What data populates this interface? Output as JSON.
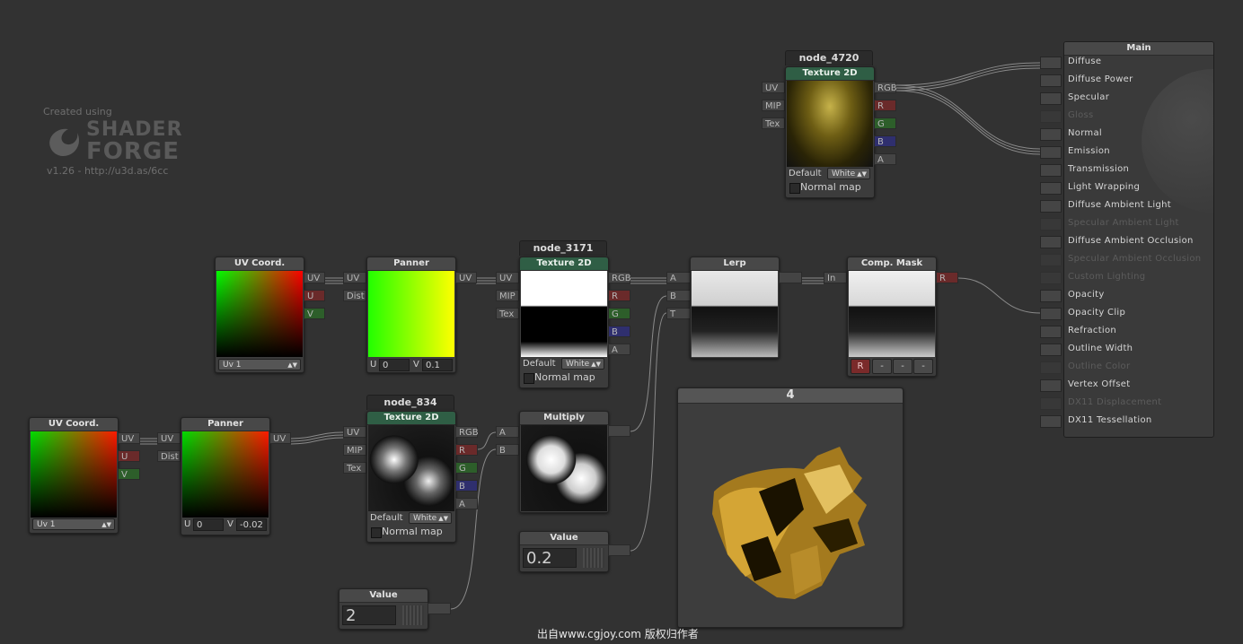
{
  "watermark": {
    "created_using": "Created using",
    "logo_line1": "SHADER",
    "logo_line2": "FORGE",
    "version": "v1.26 - http://u3d.as/6cc"
  },
  "footer_text": "出自www.cgjoy.com 版权归作者",
  "uv_coord_a": {
    "title": "UV Coord.",
    "outputs": [
      "UV",
      "U",
      "V"
    ],
    "dropdown": "Uv 1"
  },
  "uv_coord_b": {
    "title": "UV Coord.",
    "outputs": [
      "UV",
      "U",
      "V"
    ],
    "dropdown": "Uv 1"
  },
  "panner_a": {
    "title": "Panner",
    "inputs": [
      "UV",
      "Dist"
    ],
    "output": "UV",
    "u_label": "U",
    "u_value": "0",
    "v_label": "V",
    "v_value": "0.1"
  },
  "panner_b": {
    "title": "Panner",
    "inputs": [
      "UV",
      "Dist"
    ],
    "output": "UV",
    "u_label": "U",
    "u_value": "0",
    "v_label": "V",
    "v_value": "-0.02"
  },
  "node_3171": {
    "name": "node_3171",
    "title": "Texture 2D",
    "inputs": [
      "UV",
      "MIP",
      "Tex"
    ],
    "outputs": [
      "RGB",
      "R",
      "G",
      "B",
      "A"
    ],
    "default_label": "Default",
    "default_value": "White",
    "normal_map": "Normal map"
  },
  "node_834": {
    "name": "node_834",
    "title": "Texture 2D",
    "inputs": [
      "UV",
      "MIP",
      "Tex"
    ],
    "outputs": [
      "RGB",
      "R",
      "G",
      "B",
      "A"
    ],
    "default_label": "Default",
    "default_value": "White",
    "normal_map": "Normal map"
  },
  "node_4720": {
    "name": "node_4720",
    "title": "Texture 2D",
    "inputs": [
      "UV",
      "MIP",
      "Tex"
    ],
    "outputs": [
      "RGB",
      "R",
      "G",
      "B",
      "A"
    ],
    "default_label": "Default",
    "default_value": "White",
    "normal_map": "Normal map"
  },
  "lerp": {
    "title": "Lerp",
    "inputs": [
      "A",
      "B",
      "T"
    ]
  },
  "comp_mask": {
    "title": "Comp. Mask",
    "input": "In",
    "output": "R",
    "buttons": [
      "R",
      "-",
      "-",
      "-"
    ]
  },
  "multiply": {
    "title": "Multiply",
    "inputs": [
      "A",
      "B"
    ]
  },
  "value_a": {
    "title": "Value",
    "value": "0.2"
  },
  "value_b": {
    "title": "Value",
    "value": "2"
  },
  "preview": {
    "title": "4"
  },
  "main": {
    "title": "Main",
    "rows": [
      {
        "label": "Diffuse",
        "enabled": true
      },
      {
        "label": "Diffuse Power",
        "enabled": true
      },
      {
        "label": "Specular",
        "enabled": true
      },
      {
        "label": "Gloss",
        "enabled": false
      },
      {
        "label": "Normal",
        "enabled": true
      },
      {
        "label": "Emission",
        "enabled": true
      },
      {
        "label": "Transmission",
        "enabled": true
      },
      {
        "label": "Light Wrapping",
        "enabled": true
      },
      {
        "label": "Diffuse Ambient Light",
        "enabled": true
      },
      {
        "label": "Specular Ambient Light",
        "enabled": false
      },
      {
        "label": "Diffuse Ambient Occlusion",
        "enabled": true
      },
      {
        "label": "Specular Ambient Occlusion",
        "enabled": false
      },
      {
        "label": "Custom Lighting",
        "enabled": false
      },
      {
        "label": "Opacity",
        "enabled": true
      },
      {
        "label": "Opacity Clip",
        "enabled": true
      },
      {
        "label": "Refraction",
        "enabled": true
      },
      {
        "label": "Outline Width",
        "enabled": true
      },
      {
        "label": "Outline Color",
        "enabled": false
      },
      {
        "label": "Vertex Offset",
        "enabled": true
      },
      {
        "label": "DX11 Displacement",
        "enabled": false
      },
      {
        "label": "DX11 Tessellation",
        "enabled": true
      }
    ]
  }
}
